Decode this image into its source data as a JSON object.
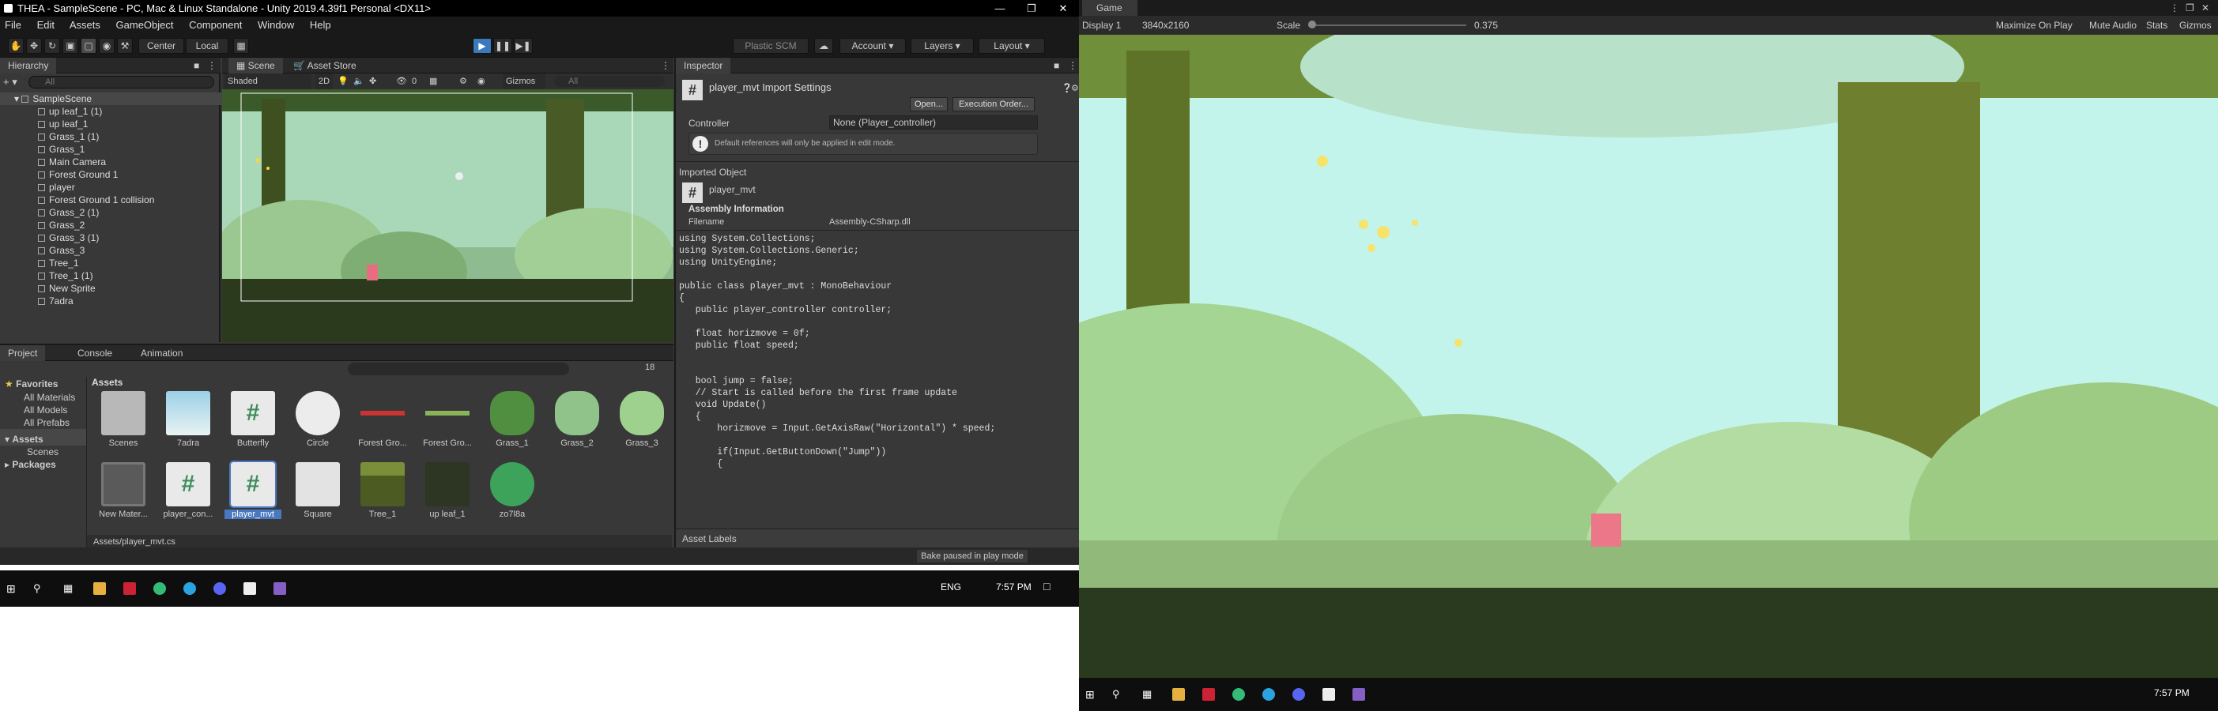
{
  "unity": {
    "title": "THEA - SampleScene - PC, Mac & Linux Standalone - Unity 2019.4.39f1 Personal <DX11>",
    "menu": [
      "File",
      "Edit",
      "Assets",
      "GameObject",
      "Component",
      "Window",
      "Help"
    ],
    "toolbar": {
      "center": "Center",
      "local": "Local",
      "plastic": "Plastic SCM",
      "account": "Account",
      "layers": "Layers",
      "layout": "Layout"
    },
    "hierarchy": {
      "tab": "Hierarchy",
      "search": "All",
      "scene": "SampleScene",
      "items": [
        "up leaf_1 (1)",
        "up leaf_1",
        "Grass_1 (1)",
        "Grass_1",
        "Main Camera",
        "Forest Ground 1",
        "player",
        "Forest Ground 1 collision",
        "Grass_2 (1)",
        "Grass_2",
        "Grass_3 (1)",
        "Grass_3",
        "Tree_1",
        "Tree_1 (1)",
        "New Sprite",
        "7adra"
      ]
    },
    "scene_tabs": {
      "scene": "Scene",
      "asset_store": "Asset Store"
    },
    "scene_bar": {
      "shaded": "Shaded",
      "mode2d": "2D",
      "gizmos": "Gizmos",
      "search": "All",
      "counter": "0"
    },
    "inspector": {
      "tab": "Inspector",
      "title": "player_mvt Import Settings",
      "open": "Open...",
      "exec_order": "Execution Order...",
      "controller_label": "Controller",
      "controller_value": "None (Player_controller)",
      "warning": "Default references will only be applied in edit mode.",
      "imported_object": "Imported Object",
      "script_name": "player_mvt",
      "assembly_info": "Assembly Information",
      "filename_label": "Filename",
      "filename_value": "Assembly-CSharp.dll",
      "code": [
        "using System.Collections;",
        "using System.Collections.Generic;",
        "using UnityEngine;",
        "",
        "public class player_mvt : MonoBehaviour",
        "{",
        "   public player_controller controller;",
        "",
        "   float horizmove = 0f;",
        "   public float speed;",
        "",
        "",
        "   bool jump = false;",
        "   // Start is called before the first frame update",
        "   void Update()",
        "   {",
        "       horizmove = Input.GetAxisRaw(\"Horizontal\") * speed;",
        "",
        "       if(Input.GetButtonDown(\"Jump\"))",
        "       {"
      ],
      "asset_labels": "Asset Labels"
    },
    "project": {
      "tabs": [
        "Project",
        "Console",
        "Animation"
      ],
      "favorites": "Favorites",
      "fav_items": [
        "All Materials",
        "All Models",
        "All Prefabs"
      ],
      "assets": "Assets",
      "scenes": "Scenes",
      "packages": "Packages",
      "assets_header": "Assets",
      "count": "18",
      "grid": [
        {
          "label": "Scenes",
          "kind": "folder"
        },
        {
          "label": "7adra",
          "kind": "cloud"
        },
        {
          "label": "Butterfly",
          "kind": "script"
        },
        {
          "label": "Circle",
          "kind": "circle"
        },
        {
          "label": "Forest Gro...",
          "kind": "redline"
        },
        {
          "label": "Forest Gro...",
          "kind": "greenline"
        },
        {
          "label": "Grass_1",
          "kind": "bush"
        },
        {
          "label": "Grass_2",
          "kind": "bush2"
        },
        {
          "label": "Grass_3",
          "kind": "bush3"
        },
        {
          "label": "New Mater...",
          "kind": "material"
        },
        {
          "label": "player_con...",
          "kind": "script"
        },
        {
          "label": "player_mvt",
          "kind": "script-selected"
        },
        {
          "label": "Square",
          "kind": "square"
        },
        {
          "label": "Tree_1",
          "kind": "tree"
        },
        {
          "label": "up leaf_1",
          "kind": "leaf"
        },
        {
          "label": "zo7l8a",
          "kind": "ball"
        }
      ],
      "path": "Assets/player_mvt.cs"
    },
    "status": "Bake paused in play mode",
    "taskbar": {
      "lang": "ENG",
      "time": "7:57 PM"
    }
  },
  "game": {
    "tab": "Game",
    "display": "Display 1",
    "resolution": "3840x2160",
    "scale_label": "Scale",
    "scale_value": "0.375",
    "maximize": "Maximize On Play",
    "mute": "Mute Audio",
    "stats": "Stats",
    "gizmos": "Gizmos",
    "time": "7:57 PM"
  }
}
